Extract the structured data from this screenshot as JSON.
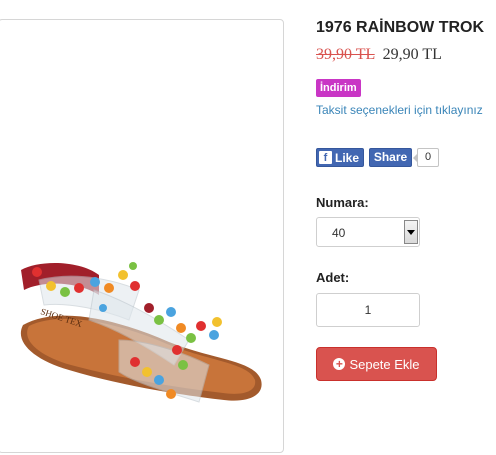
{
  "product": {
    "title": "1976 RAİNBOW TROK",
    "old_price": "39,90 TL",
    "new_price": "29,90 TL",
    "discount_badge": "İndirim",
    "installment_link": "Taksit seçenekleri için tıklayınız",
    "image_brand_text": "SHOE TEX"
  },
  "social": {
    "like_label": "Like",
    "share_label": "Share",
    "share_count": "0"
  },
  "options": {
    "size_label": "Numara:",
    "size_value": "40",
    "qty_label": "Adet:",
    "qty_value": "1"
  },
  "cart": {
    "add_label": "Sepete Ekle"
  },
  "colors": {
    "discount": "#c936c5",
    "link": "#3a85b8",
    "cart_button": "#d9534f",
    "facebook": "#4267b2"
  },
  "icons": {
    "facebook": "facebook-f-icon",
    "add": "plus-circle-icon",
    "dropdown": "chevron-down-icon"
  }
}
